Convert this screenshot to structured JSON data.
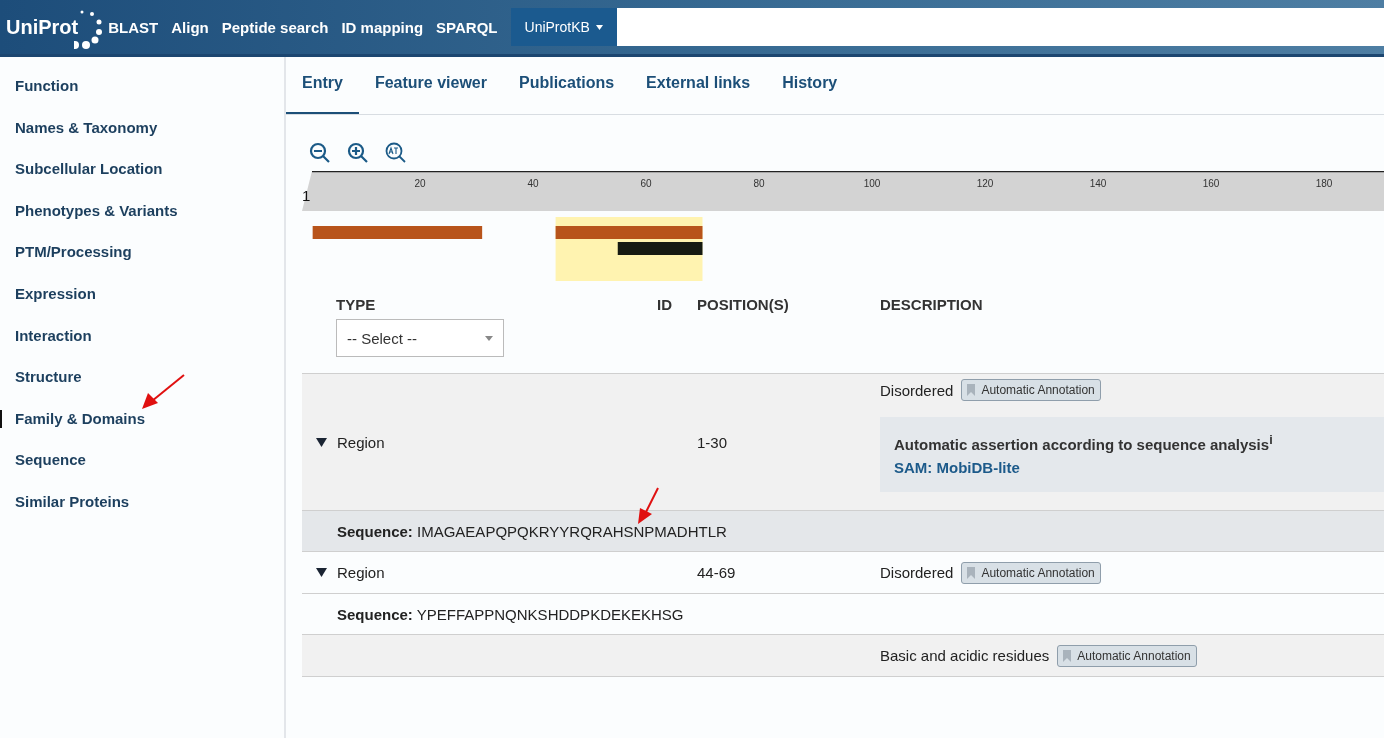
{
  "header": {
    "logo": "UniProt",
    "nav": [
      "BLAST",
      "Align",
      "Peptide search",
      "ID mapping",
      "SPARQL"
    ],
    "database": {
      "value": "UniProtKB"
    }
  },
  "sidebar": {
    "items": [
      {
        "label": "Function",
        "selected": false
      },
      {
        "label": "Names & Taxonomy",
        "selected": false
      },
      {
        "label": "Subcellular Location",
        "selected": false
      },
      {
        "label": "Phenotypes & Variants",
        "selected": false
      },
      {
        "label": "PTM/Processing",
        "selected": false
      },
      {
        "label": "Expression",
        "selected": false
      },
      {
        "label": "Interaction",
        "selected": false
      },
      {
        "label": "Structure",
        "selected": false
      },
      {
        "label": "Family & Domains",
        "selected": true
      },
      {
        "label": "Sequence",
        "selected": false
      },
      {
        "label": "Similar Proteins",
        "selected": false
      }
    ]
  },
  "tabs": [
    {
      "label": "Entry",
      "selected": true
    },
    {
      "label": "Feature viewer",
      "selected": false
    },
    {
      "label": "Publications",
      "selected": false
    },
    {
      "label": "External links",
      "selected": false
    },
    {
      "label": "History",
      "selected": false
    }
  ],
  "feature_viewer": {
    "ruler_start": "1",
    "ticks": [
      "20",
      "40",
      "60",
      "80",
      "100",
      "120",
      "140",
      "160",
      "180"
    ]
  },
  "table": {
    "columns": [
      "TYPE",
      "ID",
      "POSITION(S)",
      "DESCRIPTION"
    ],
    "type_filter": {
      "value": "-- Select --"
    },
    "rows": [
      {
        "type": "Region",
        "expanded": true,
        "shaded": true,
        "selected": false,
        "position": "1-30",
        "description": "Disordered",
        "badge": "Automatic Annotation",
        "evidence": {
          "text": "Automatic assertion according to sequence analysis$^{i}$",
          "link": "SAM: MobiDB-lite"
        },
        "sequence": "**Sequence:** IMAGAEAPQPQKRYYRQRAHSNPMADHTLR"
      },
      {
        "type": "Region",
        "expanded": true,
        "shaded": false,
        "selected": true,
        "position": "44-69",
        "description": "Disordered",
        "badge": "Automatic Annotation",
        "sequence": "**Sequence:** YPEFFAPPNQNKSHDDPKDEKEKHSG"
      },
      {
        "shaded": true,
        "selected": false,
        "description": "Basic and acidic residues",
        "badge": "Automatic Annotation"
      }
    ]
  }
}
